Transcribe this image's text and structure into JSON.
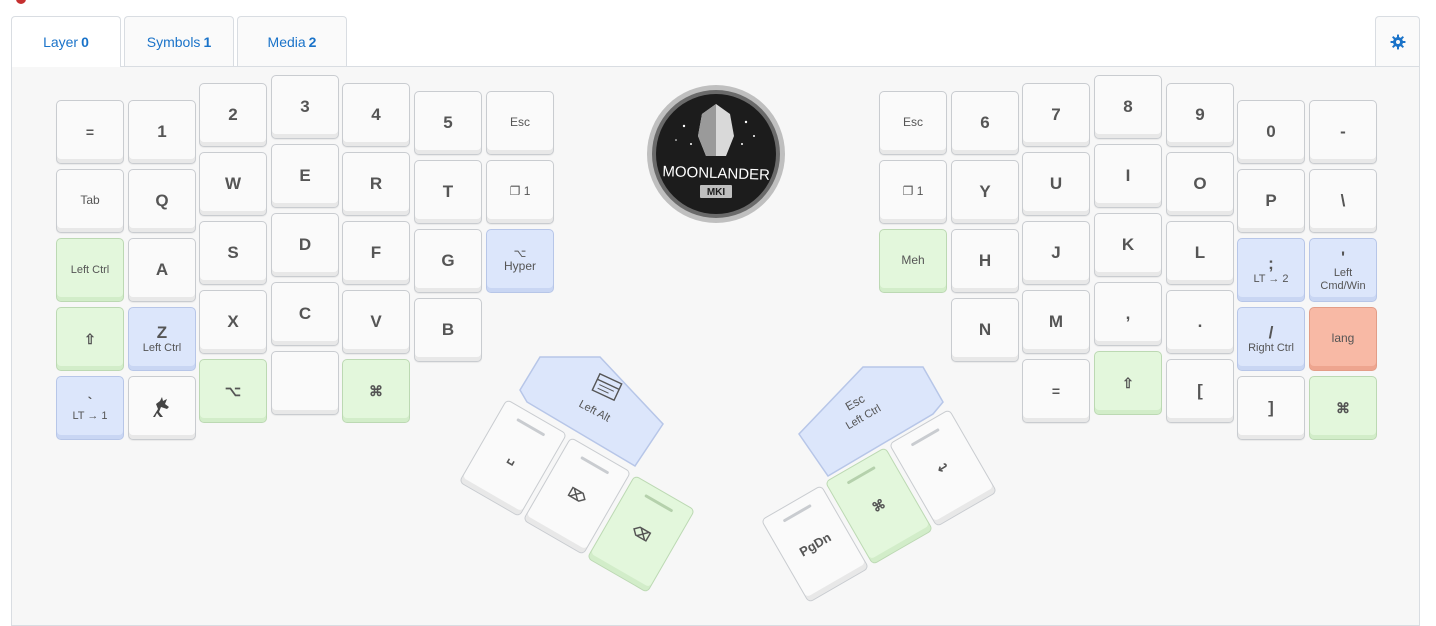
{
  "tabs": [
    {
      "label": "Layer",
      "num": "0"
    },
    {
      "label": "Symbols",
      "num": "1"
    },
    {
      "label": "Media",
      "num": "2"
    }
  ],
  "settings": {
    "icon": "gear-icon"
  },
  "logo": {
    "text_main": "MOONLANDER",
    "text_sub": "MKI"
  },
  "colors": {
    "accent": "#1a73c9",
    "green": "#e3f7dc",
    "blue": "#dce6fb",
    "orange": "#f8b9a5"
  },
  "keys": {
    "L_eq": {
      "main": "="
    },
    "L_1": {
      "main": "1"
    },
    "L_2": {
      "main": "2"
    },
    "L_3": {
      "main": "3"
    },
    "L_4": {
      "main": "4"
    },
    "L_5": {
      "main": "5"
    },
    "L_esc": {
      "main": "Esc"
    },
    "L_tab": {
      "main": "Tab"
    },
    "L_q": {
      "main": "Q"
    },
    "L_w": {
      "main": "W"
    },
    "L_e": {
      "main": "E"
    },
    "L_r": {
      "main": "R"
    },
    "L_t": {
      "main": "T"
    },
    "L_layer1": {
      "main": "❐ 1"
    },
    "L_ctrl": {
      "main": "Left Ctrl"
    },
    "L_a": {
      "main": "A"
    },
    "L_s": {
      "main": "S"
    },
    "L_d": {
      "main": "D"
    },
    "L_f": {
      "main": "F"
    },
    "L_g": {
      "main": "G"
    },
    "L_hyper": {
      "top": "⌥",
      "main": "Hyper"
    },
    "L_shift": {
      "main": "⇧"
    },
    "L_z": {
      "main": "Z",
      "sub": "Left Ctrl"
    },
    "L_x": {
      "main": "X"
    },
    "L_c": {
      "main": "C"
    },
    "L_v": {
      "main": "V"
    },
    "L_b": {
      "main": "B"
    },
    "L_grave": {
      "main": "`",
      "sub": "LT → 1"
    },
    "L_alt": {
      "main": "⌥"
    },
    "L_cmd": {
      "main": "⌘"
    },
    "L_red_main": {
      "main": "Left Alt"
    },
    "R_esc": {
      "main": "Esc"
    },
    "R_6": {
      "main": "6"
    },
    "R_7": {
      "main": "7"
    },
    "R_8": {
      "main": "8"
    },
    "R_9": {
      "main": "9"
    },
    "R_0": {
      "main": "0"
    },
    "R_minus": {
      "main": "-"
    },
    "R_layer1": {
      "main": "❐ 1"
    },
    "R_y": {
      "main": "Y"
    },
    "R_u": {
      "main": "U"
    },
    "R_i": {
      "main": "I"
    },
    "R_o": {
      "main": "O"
    },
    "R_p": {
      "main": "P"
    },
    "R_bslash": {
      "main": "\\"
    },
    "R_meh": {
      "main": "Meh"
    },
    "R_h": {
      "main": "H"
    },
    "R_j": {
      "main": "J"
    },
    "R_k": {
      "main": "K"
    },
    "R_l": {
      "main": "L"
    },
    "R_semi": {
      "main": ";",
      "sub": "LT → 2"
    },
    "R_quote": {
      "main": "'",
      "sub": "Left Cmd/Win"
    },
    "R_n": {
      "main": "N"
    },
    "R_m": {
      "main": "M"
    },
    "R_comma": {
      "main": ","
    },
    "R_dot": {
      "main": "."
    },
    "R_slash": {
      "main": "/",
      "sub": "Right Ctrl"
    },
    "R_lang": {
      "main": "lang"
    },
    "R_eq": {
      "main": "="
    },
    "R_shift": {
      "main": "⇧"
    },
    "R_lbr": {
      "main": "["
    },
    "R_rbr": {
      "main": "]"
    },
    "R_cmd": {
      "main": "⌘"
    },
    "R_red_top": {
      "main": "Esc"
    },
    "R_red_sub": {
      "main": "Left Ctrl"
    }
  },
  "thumbs_left": [
    {
      "main": "␣"
    },
    {
      "main": "⌦"
    },
    {
      "main": "⌫"
    }
  ],
  "thumbs_right": [
    {
      "main": "PgDn"
    },
    {
      "main": "⌘"
    },
    {
      "main": "↩"
    }
  ]
}
